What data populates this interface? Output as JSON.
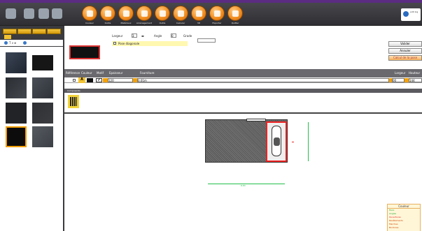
{
  "toolbar": {
    "buttons": [
      {
        "label": "Couleur"
      },
      {
        "label": "Outils"
      },
      {
        "label": "Matériaux"
      },
      {
        "label": "Aménagement"
      },
      {
        "label": "Outils"
      },
      {
        "label": "Calculer"
      },
      {
        "label": "3D"
      },
      {
        "label": "Exporter"
      },
      {
        "label": "Quitter"
      }
    ],
    "logo_text": "edit\nlog"
  },
  "left": {
    "category_tabs": [
      "",
      "",
      "",
      ""
    ],
    "tools_text": "T  ∂  ⊕"
  },
  "form": {
    "label_width": "Largeur",
    "value_width": "3",
    "label_angle": "Angle",
    "value_angle": "0",
    "label_grade": "Grade",
    "note": "Vue aleatoire",
    "checkbox_label": "Pose diagonale",
    "btn_valider": "Valider",
    "btn_annuler": "Annuler",
    "btn_calculer": "Calcul de la pose"
  },
  "table": {
    "headers": [
      "Référence",
      "Couleur",
      "Motif",
      "Epaisseur",
      "Fourniture",
      "Largeur",
      "Hauteur"
    ],
    "row": {
      "letter": "A",
      "value1": "120",
      "value2": "0.01m",
      "value3": "00",
      "value4": "144"
    }
  },
  "section_band": "Composants",
  "canvas": {
    "dimension_label": "8.83"
  },
  "legend": {
    "title": "Couleur",
    "items": [
      {
        "label": "Murs",
        "color": "#22aa33"
      },
      {
        "label": "Angles",
        "color": "#22aa33"
      },
      {
        "label": "Ouvertures",
        "color": "#dd2222"
      },
      {
        "label": "Revêtements",
        "color": "#cc4400"
      },
      {
        "label": "Marches",
        "color": "#cc4400"
      },
      {
        "label": "Bordures",
        "color": "#cc4400"
      }
    ]
  }
}
